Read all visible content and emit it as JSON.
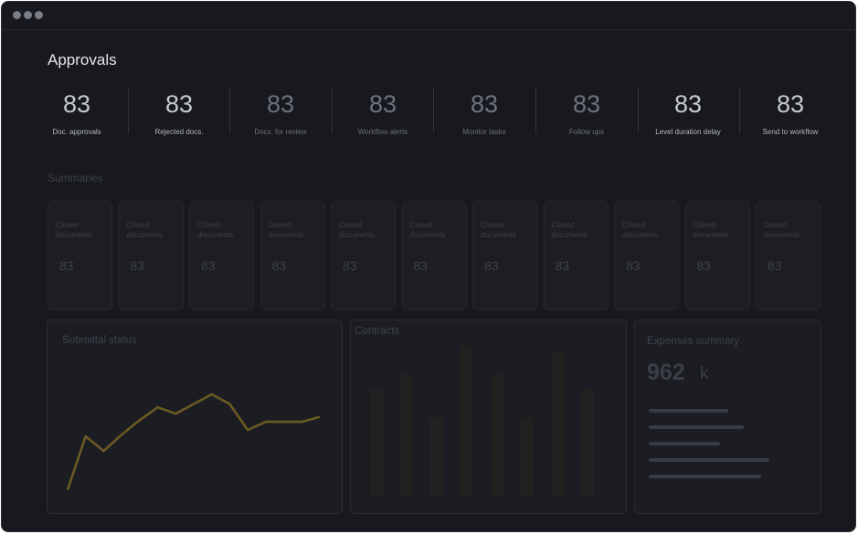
{
  "window": {
    "controls": [
      "window-dot",
      "window-dot",
      "window-dot"
    ]
  },
  "page": {
    "title": "Approvals"
  },
  "stats": [
    {
      "value": "83",
      "label": "Doc. approvals",
      "dim": false
    },
    {
      "value": "83",
      "label": "Rejected docs.",
      "dim": false
    },
    {
      "value": "83",
      "label": "Docs. for review",
      "dim": true
    },
    {
      "value": "83",
      "label": "Workflow alerts",
      "dim": true
    },
    {
      "value": "83",
      "label": "Monitor tasks",
      "dim": true
    },
    {
      "value": "83",
      "label": "Follow ups",
      "dim": true
    },
    {
      "value": "83",
      "label": "Level duration delay",
      "dim": false
    },
    {
      "value": "83",
      "label": "Send to workflow",
      "dim": false
    }
  ],
  "summaries": {
    "title": "Summaries",
    "cards": [
      {
        "label": "Closed documents",
        "value": "83"
      },
      {
        "label": "Closed documents",
        "value": "83"
      },
      {
        "label": "Closed documents",
        "value": "83"
      },
      {
        "label": "Closed documents",
        "value": "83"
      },
      {
        "label": "Closed documents",
        "value": "83"
      },
      {
        "label": "Closed documents",
        "value": "83"
      },
      {
        "label": "Closed documents",
        "value": "83"
      },
      {
        "label": "Closed documents",
        "value": "83"
      },
      {
        "label": "Closed documents",
        "value": "83"
      },
      {
        "label": "Closed documents",
        "value": "83"
      },
      {
        "label": "Closed documents",
        "value": "83"
      }
    ]
  },
  "submittal": {
    "title": "Submittal status",
    "line_color": "#6b5a22",
    "values": [
      2,
      35,
      26,
      36,
      45,
      53,
      49,
      55,
      61,
      55,
      39,
      44,
      44,
      44,
      47
    ]
  },
  "contracts": {
    "title": "Contracts",
    "bar_color": "#22211f",
    "values": [
      71,
      81,
      52,
      100,
      81,
      52,
      96,
      71
    ]
  },
  "expenses": {
    "title": "Expenses summary",
    "value": "962",
    "unit": "k",
    "line_color": "#383b45"
  }
}
